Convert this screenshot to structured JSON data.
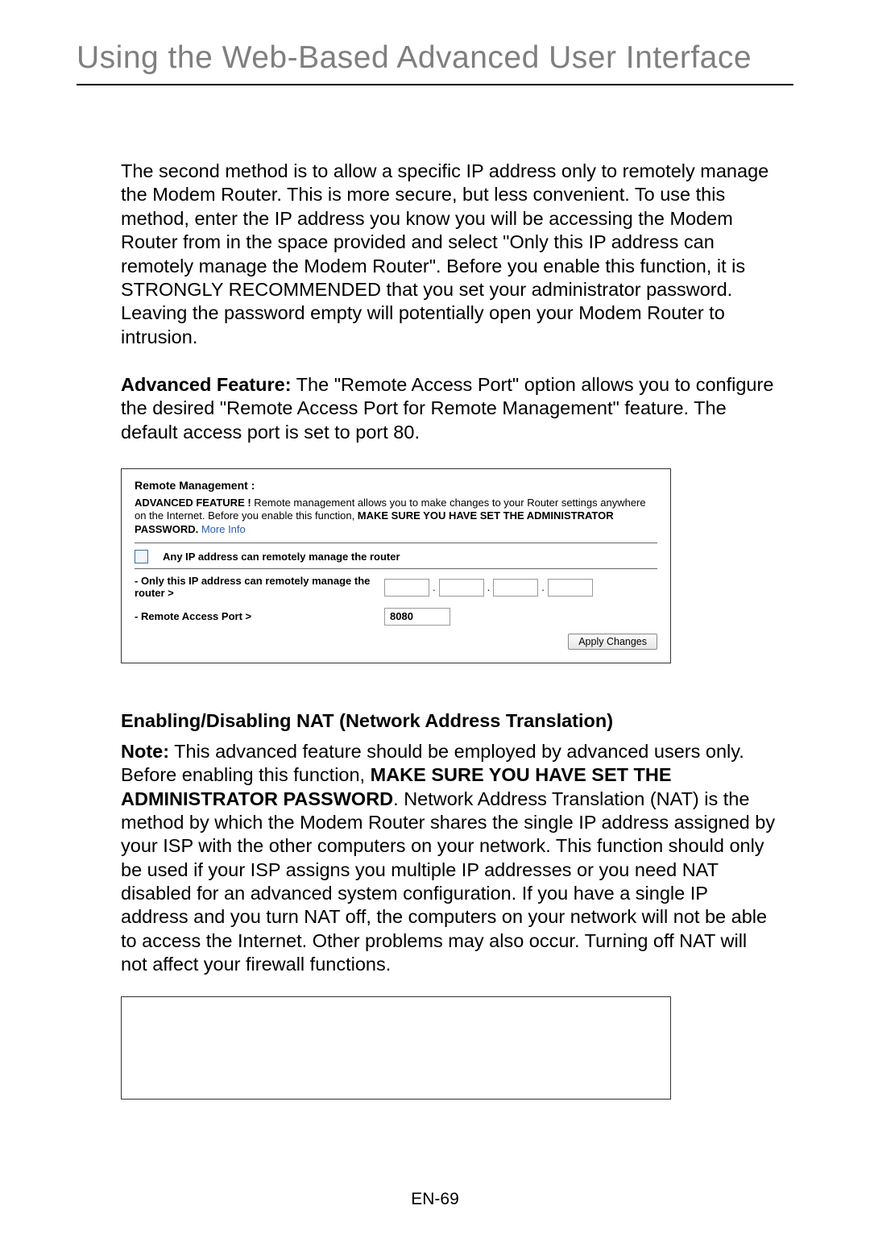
{
  "page_title": "Using the Web-Based Advanced User Interface",
  "para1": "The second method is to allow a specific IP address only to remotely manage the Modem Router. This is more secure, but less convenient. To use this method, enter the IP address you know you will be accessing the Modem Router from in the space provided and select \"Only this IP address can remotely manage the Modem Router\". Before you enable this function, it is STRONGLY RECOMMENDED that you set your administrator password. Leaving the password empty will potentially open your Modem Router to intrusion.",
  "advanced_feature_label": "Advanced Feature:",
  "para2_rest": " The \"Remote Access Port\" option allows you to configure the desired \"Remote Access Port for Remote Management\" feature. The default access port is set to port 80.",
  "remote_mgmt": {
    "heading": "Remote Management :",
    "desc_prefix": "ADVANCED FEATURE !",
    "desc_text": " Remote management allows you to make changes to your Router settings anywhere on the Internet. Before you enable this function, ",
    "desc_bold": "MAKE SURE YOU HAVE SET THE ADMINISTRATOR PASSWORD.",
    "more_info": "More Info",
    "any_ip_label": "Any IP address can remotely manage the router",
    "only_ip_label": "- Only this IP address can remotely manage the router >",
    "ip": [
      "",
      "",
      "",
      ""
    ],
    "port_label": "- Remote Access Port >",
    "port_value": "8080",
    "apply_label": "Apply Changes"
  },
  "nat_heading": "Enabling/Disabling NAT (Network Address Translation)",
  "note_label": "Note:",
  "para3_part1": " This advanced feature should be employed by advanced users only. Before enabling this function, ",
  "para3_bold": "MAKE SURE YOU HAVE SET THE ADMINISTRATOR PASSWORD",
  "para3_part2": ". Network Address Translation (NAT) is the method by which the Modem Router shares the single IP address assigned by your ISP with the other computers on your network. This function should only be used if your ISP assigns you multiple IP addresses or you need NAT disabled for an advanced system configuration. If you have a single IP address and you turn NAT off, the computers on your network will not be able to access the Internet. Other problems may also occur. Turning off NAT will not affect your firewall functions.",
  "page_number": "EN-69"
}
